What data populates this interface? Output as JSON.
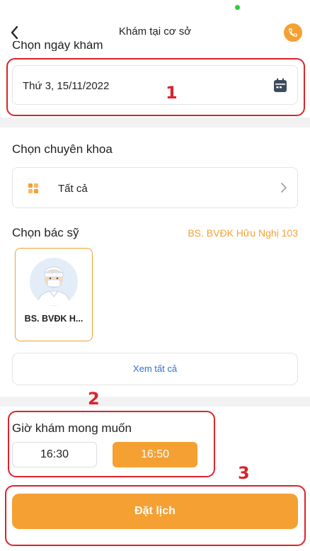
{
  "header": {
    "title": "Khám tại cơ sở"
  },
  "date_section": {
    "title": "Chọn ngày khám",
    "value": "Thứ 3, 15/11/2022"
  },
  "specialty_section": {
    "title": "Chọn chuyên khoa",
    "value": "Tất cả"
  },
  "doctor_section": {
    "title": "Chọn bác sỹ",
    "selected_link": "BS. BVĐK Hữu Nghị 103",
    "doctors": [
      {
        "name": "BS. BVĐK H..."
      }
    ],
    "see_all_label": "Xem tất cả"
  },
  "time_section": {
    "title": "Giờ khám mong muốn",
    "slots": [
      "16:30",
      "16:50"
    ]
  },
  "book_button": {
    "label": "Đặt lịch"
  },
  "annotations": {
    "labels": [
      "1",
      "2",
      "3"
    ]
  },
  "colors": {
    "accent": "#f5a033",
    "annotation_red": "#d9242c",
    "link_blue": "#2f6fd6",
    "status_green": "#2ecc40"
  }
}
